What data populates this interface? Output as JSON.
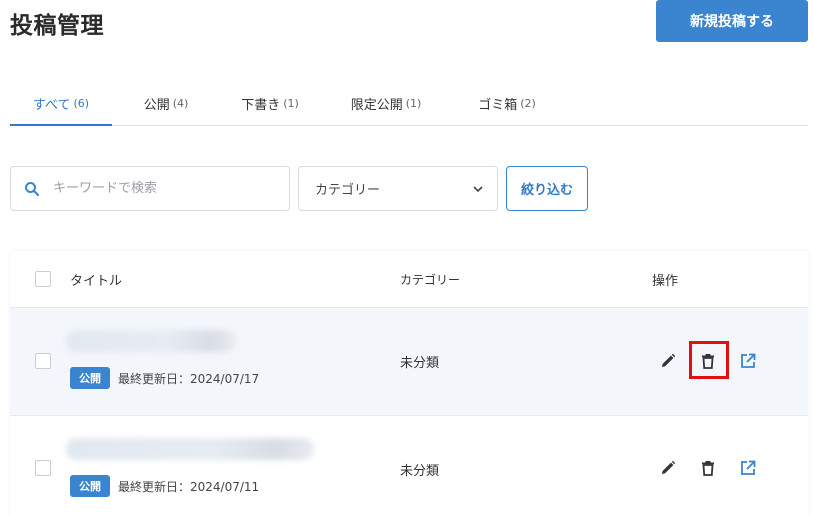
{
  "header": {
    "title": "投稿管理",
    "new_post_label": "新規投稿する"
  },
  "tabs": [
    {
      "label": "すべて",
      "count": "(6)",
      "active": true
    },
    {
      "label": "公開",
      "count": "(4)",
      "active": false
    },
    {
      "label": "下書き",
      "count": "(1)",
      "active": false
    },
    {
      "label": "限定公開",
      "count": "(1)",
      "active": false
    },
    {
      "label": "ゴミ箱",
      "count": "(2)",
      "active": false
    }
  ],
  "filters": {
    "search_placeholder": "キーワードで検索",
    "category_value": "カテゴリー",
    "filter_button_label": "絞り込む"
  },
  "table": {
    "headers": {
      "title": "タイトル",
      "category": "カテゴリー",
      "actions": "操作"
    },
    "rows": [
      {
        "status": "公開",
        "updated": "最終更新日：2024/07/17",
        "category": "未分類"
      },
      {
        "status": "公開",
        "updated": "最終更新日：2024/07/11",
        "category": "未分類"
      }
    ]
  },
  "colors": {
    "accent": "#3a84d0",
    "highlight": "#e01010"
  },
  "icons": {
    "search": "search-icon",
    "chevron": "chevron-down-icon",
    "edit": "pencil-icon",
    "delete": "trash-icon",
    "view": "external-link-icon"
  }
}
